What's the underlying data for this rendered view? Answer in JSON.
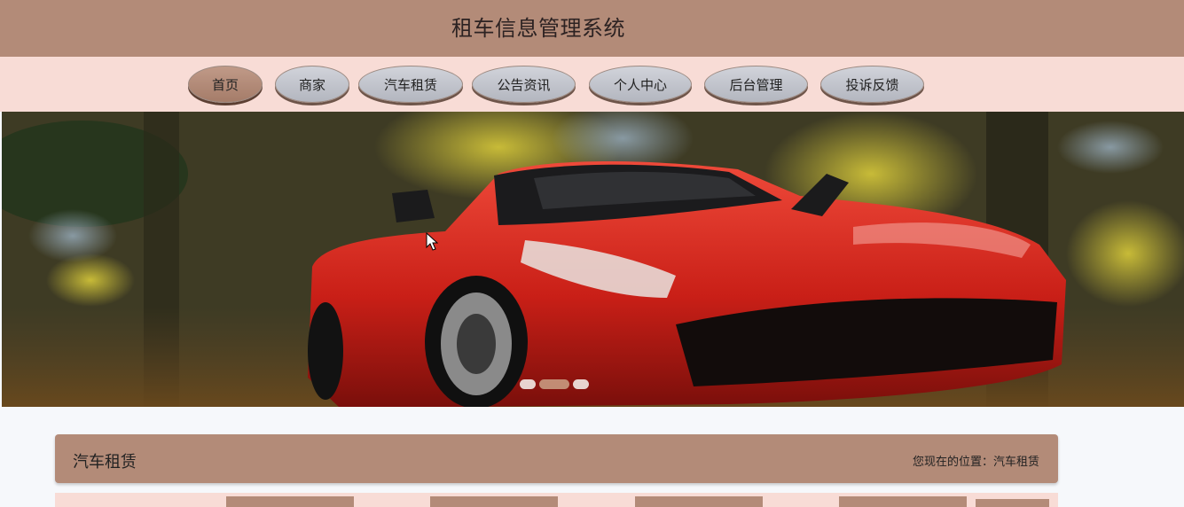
{
  "header": {
    "title": "租车信息管理系统"
  },
  "nav": {
    "items": [
      {
        "label": "首页",
        "active": true
      },
      {
        "label": "商家"
      },
      {
        "label": "汽车租赁"
      },
      {
        "label": "公告资讯"
      },
      {
        "label": "个人中心"
      },
      {
        "label": "后台管理"
      },
      {
        "label": "投诉反馈"
      }
    ]
  },
  "banner": {
    "slide_count": 3,
    "active_slide": 2
  },
  "section": {
    "title": "汽车租赁",
    "breadcrumb": "您现在的位置：汽车租赁"
  },
  "colors": {
    "header": "#b38b78",
    "nav_bg": "#f8dcd6",
    "button": "#c5c7cf",
    "button_active": "#b38b78",
    "car_red": "#d42a22"
  }
}
